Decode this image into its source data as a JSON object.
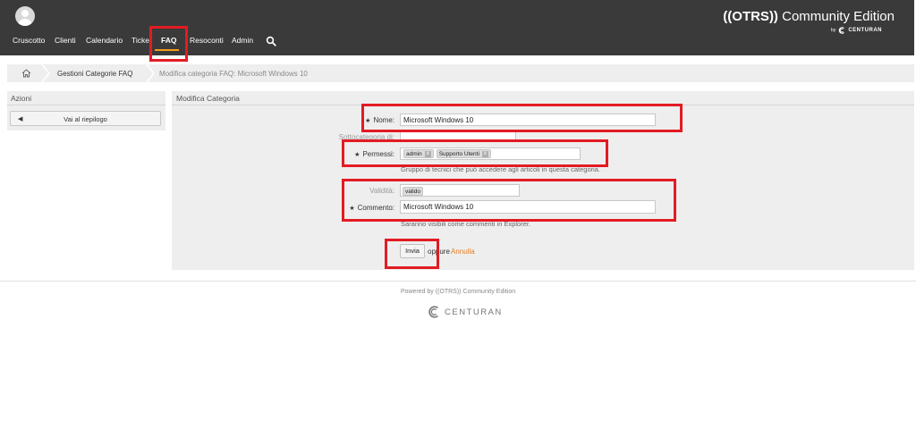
{
  "header": {
    "nav": [
      {
        "label": "Cruscotto"
      },
      {
        "label": "Clienti"
      },
      {
        "label": "Calendario"
      },
      {
        "label": "Ticke"
      },
      {
        "label": "FAQ",
        "active": true
      },
      {
        "label": "Resoconti"
      },
      {
        "label": "Admin"
      }
    ],
    "brand_prefix": "((OTRS))",
    "brand_suffix": " Community Edition",
    "by": "by",
    "by_company": "CENTURAN",
    "accent_color": "#f59c1a",
    "icons": [
      "user-avatar",
      "search-icon",
      "centuran-logo"
    ]
  },
  "breadcrumb": {
    "items": [
      "Gestioni Categorie FAQ",
      "Modifica categoria FAQ: Microsoft Windows 10"
    ],
    "home_icon": "home-icon"
  },
  "sidebar": {
    "title": "Azioni",
    "back_label": "Vai al riepilogo"
  },
  "form": {
    "title": "Modifica Categoria",
    "name_label": "Nome:",
    "name_value": "Microsoft Windows 10",
    "parent_label": "Sottocategoria di:",
    "permissions_label": "Permessi:",
    "permissions": [
      "admin",
      "Supporto Utenti"
    ],
    "permissions_hint": "Gruppo di tecnici che può accedere agli articoli in questa categoria.",
    "validity_label": "Validità:",
    "validity_value": "valido",
    "comment_label": "Commento:",
    "comment_value": "Microsoft Windows 10",
    "comment_hint": "Saranno visibili come commenti in Explorer.",
    "required_mark": "★",
    "tag_remove": "x",
    "submit_label": "Invia",
    "or_label": "oppure",
    "cancel_label": "Annulla",
    "link_color": "#e67e22"
  },
  "annotation_color": "#e31b23",
  "footer": {
    "powered": "Powered by ((OTRS)) Community Edition",
    "logo_text": "CENTURAN"
  }
}
